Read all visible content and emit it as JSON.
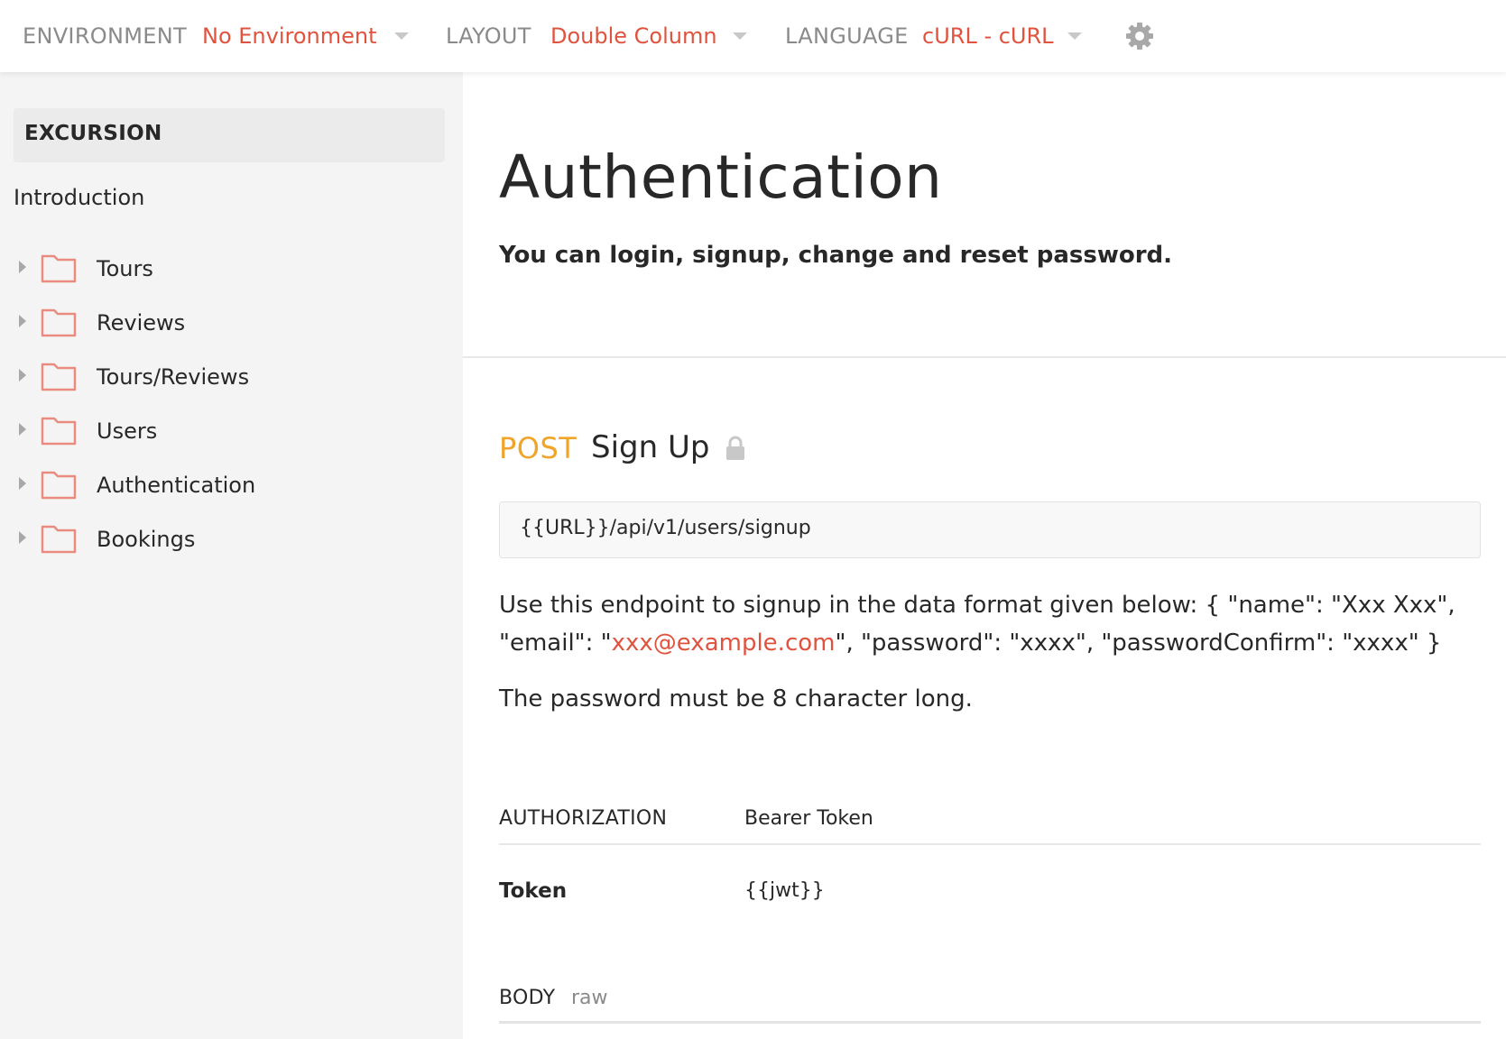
{
  "topbar": {
    "environment_label": "ENVIRONMENT",
    "environment_value": "No Environment",
    "layout_label": "LAYOUT",
    "layout_value": "Double Column",
    "language_label": "LANGUAGE",
    "language_value": "cURL - cURL",
    "settings_icon": "gear-icon"
  },
  "sidebar": {
    "collection_title": "EXCURSION",
    "intro": "Introduction",
    "folders": [
      {
        "label": "Tours"
      },
      {
        "label": "Reviews"
      },
      {
        "label": "Tours/Reviews"
      },
      {
        "label": "Users"
      },
      {
        "label": "Authentication"
      },
      {
        "label": "Bookings"
      }
    ]
  },
  "main": {
    "title": "Authentication",
    "subtitle": "You can login, signup, change and reset password.",
    "request": {
      "method": "POST",
      "name": "Sign Up",
      "url": "{{URL}}/api/v1/users/signup",
      "description_before": "Use this endpoint to signup in the data format given below: { \"name\": \"Xxx Xxx\", \"email\": \"",
      "description_link": "xxx@example.com",
      "description_after": "\", \"password\": \"xxxx\", \"passwordConfirm\": \"xxxx\" }",
      "description_2": "The password must be 8 character long.",
      "authorization_label": "AUTHORIZATION",
      "authorization_type": "Bearer Token",
      "token_label": "Token",
      "token_value": "{{jwt}}",
      "body_label": "BODY",
      "body_type": "raw"
    }
  },
  "colors": {
    "accent": "#e0533f",
    "post_method": "#f0a52a",
    "folder_icon": "#e98b7e",
    "sidebar_bg": "#f4f4f4"
  }
}
